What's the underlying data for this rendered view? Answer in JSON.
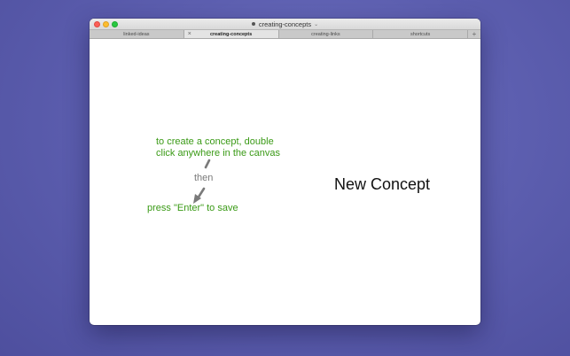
{
  "window": {
    "title": "creating-concepts"
  },
  "tabs": [
    {
      "label": "linked-ideas",
      "active": false
    },
    {
      "label": "creating-concepts",
      "active": true
    },
    {
      "label": "creating-links",
      "active": false
    },
    {
      "label": "shortcuts",
      "active": false
    }
  ],
  "tab_close_glyph": "×",
  "tab_add_glyph": "+",
  "canvas": {
    "hint_create_line1": "to create a concept, double",
    "hint_create_line2": "click anywhere in the canvas",
    "then": "then",
    "hint_save": "press \"Enter\" to save",
    "concept_label": "New Concept"
  },
  "colors": {
    "hint_green": "#3a9a16",
    "then_gray": "#7a7a7a",
    "desktop": "#5d5fb0"
  }
}
